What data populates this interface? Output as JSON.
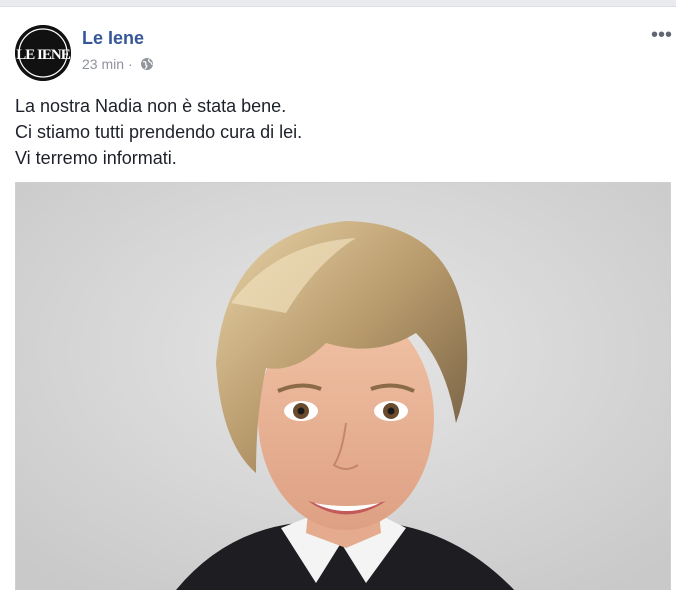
{
  "post": {
    "page_name": "Le Iene",
    "timestamp": "23 min",
    "separator": "·",
    "privacy_icon": "globe-icon",
    "more_icon": "more-options-icon",
    "text_lines": [
      "La nostra Nadia non è stata bene.",
      "Ci stiamo tutti prendendo cura di lei.",
      "Vi terremo informati."
    ],
    "avatar": {
      "logo_text": "LE IENE"
    }
  },
  "colors": {
    "page_name": "#365899",
    "meta": "#90949c",
    "text": "#1d2129"
  }
}
